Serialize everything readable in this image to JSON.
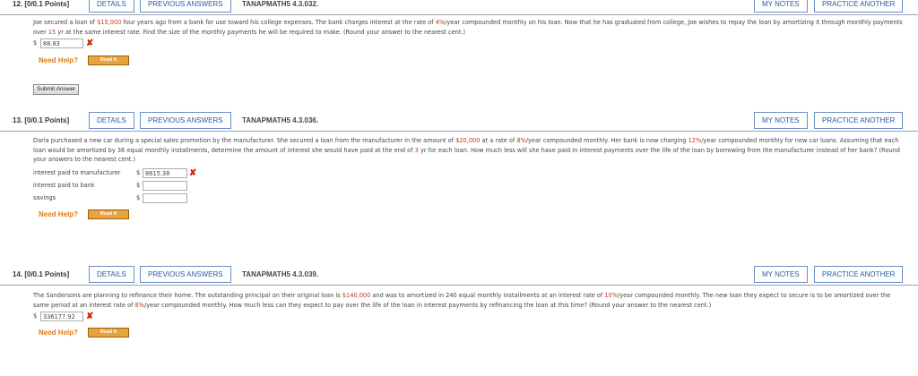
{
  "q12": {
    "number": "12. [0/0.1 Points]",
    "details": "DETAILS",
    "previous": "PREVIOUS ANSWERS",
    "code": "TANAPMATH5 4.3.032.",
    "my_notes": "MY NOTES",
    "practice": "PRACTICE ANOTHER",
    "text_a": "Joe secured a loan of ",
    "amount": "$15,000",
    "text_b": " four years ago from a bank for use toward his college expenses. The bank charges interest at the rate of ",
    "rate": "4%",
    "text_c": "/year compounded monthly on his loan. Now that he has graduated from college, Joe wishes to repay the loan by amortizing it through monthly payments over ",
    "years": "15",
    "text_d": " yr at the same interest rate. Find the size of the monthly payments he will be required to make. (Round your answer to the nearest cent.)",
    "currency": "$",
    "answer": "88.83",
    "need_help": "Need Help?",
    "read_it": "Read It",
    "submit": "Submit Answer"
  },
  "q13": {
    "number": "13. [0/0.1 Points]",
    "details": "DETAILS",
    "previous": "PREVIOUS ANSWERS",
    "code": "TANAPMATH5 4.3.036.",
    "my_notes": "MY NOTES",
    "practice": "PRACTICE ANOTHER",
    "text_a": "Darla purchased a new car during a special sales promotion by the manufacturer. She secured a loan from the manufacturer in the amount of ",
    "amount": "$20,000",
    "text_b": " at a rate of ",
    "rate1": "8%",
    "text_c": "/year compounded monthly. Her bank is now charging ",
    "rate2": "12%",
    "text_d": "/year compounded monthly for new car loans. Assuming that each loan would be amortized by 36 equal monthly installments, determine the amount of interest she would have paid at the end of ",
    "years": "3",
    "text_e": " yr for each loan. How much less will she have paid in interest payments over the life of the loan by borrowing from the manufacturer instead of her bank? (Round your answers to the nearest cent.)",
    "rows": [
      {
        "label": "interest paid to manufacturer",
        "currency": "$",
        "value": "8615.38"
      },
      {
        "label": "interest paid to bank",
        "currency": "$",
        "value": ""
      },
      {
        "label": "savings",
        "currency": "$",
        "value": ""
      }
    ],
    "need_help": "Need Help?",
    "read_it": "Read It"
  },
  "q14": {
    "number": "14. [0/0.1 Points]",
    "details": "DETAILS",
    "previous": "PREVIOUS ANSWERS",
    "code": "TANAPMATH5 4.3.039.",
    "my_notes": "MY NOTES",
    "practice": "PRACTICE ANOTHER",
    "text_a": "The Sandersons are planning to refinance their home. The outstanding principal on their original loan is ",
    "amount": "$140,000",
    "text_b": " and was to amortized in 240 equal monthly installments at an interest rate of ",
    "rate1": "10%",
    "text_c": "/year compounded monthly. The new loan they expect to secure is to be amortized over the same period at an interest rate of ",
    "rate2": "8%",
    "text_d": "/year compounded monthly. How much less can they expect to pay over the life of the loan in interest payments by refinancing the loan at this time? (Round your answer to the nearest cent.)",
    "currency": "$",
    "answer": "336177.92",
    "need_help": "Need Help?",
    "read_it": "Read It"
  },
  "colors": {
    "accent_blue": "#2a5aa3",
    "highlight_red": "#c8351c",
    "help_orange": "#e07a14",
    "readit_orange": "#e8a33a"
  }
}
